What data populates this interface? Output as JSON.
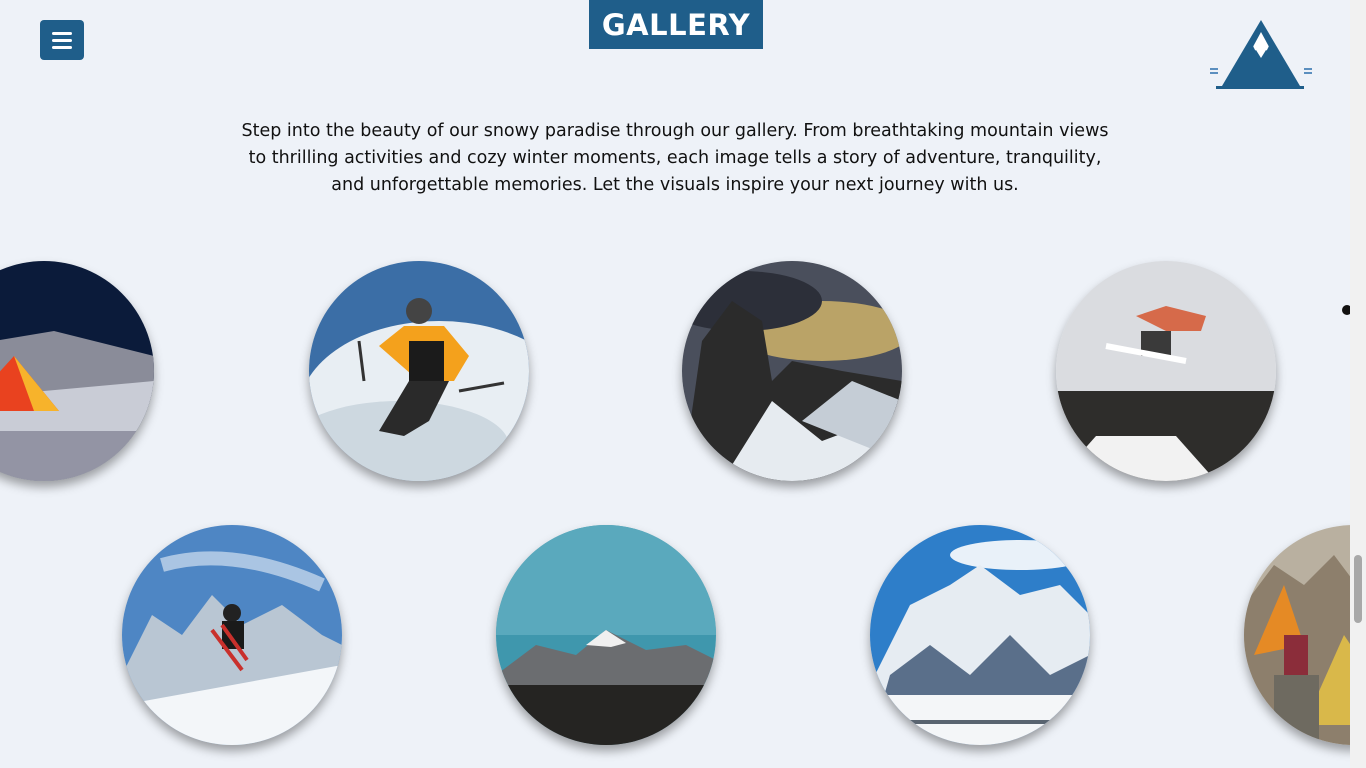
{
  "header": {
    "title": "GALLERY",
    "menu_icon": "hamburger-icon",
    "logo_icon": "mountain-logo-icon"
  },
  "intro": {
    "text": "Step into the beauty of our snowy paradise through our gallery. From breathtaking mountain views to thrilling activities and cozy winter moments, each image tells a story of adventure, tranquility, and unforgettable memories. Let the visuals inspire your next journey with us."
  },
  "gallery": {
    "items": [
      {
        "subject": "tent-in-snow-at-night"
      },
      {
        "subject": "skier-yellow-jacket"
      },
      {
        "subject": "rocky-peak-with-cross-at-sunset"
      },
      {
        "subject": "snowboarder-jumping"
      },
      {
        "subject": "skier-jumping-mountains"
      },
      {
        "subject": "mountain-peak-teal-sky"
      },
      {
        "subject": "snowy-mountain-range"
      },
      {
        "subject": "climbers-with-tents"
      }
    ]
  },
  "colors": {
    "accent": "#1f5e8a",
    "background": "#eef2f8"
  }
}
